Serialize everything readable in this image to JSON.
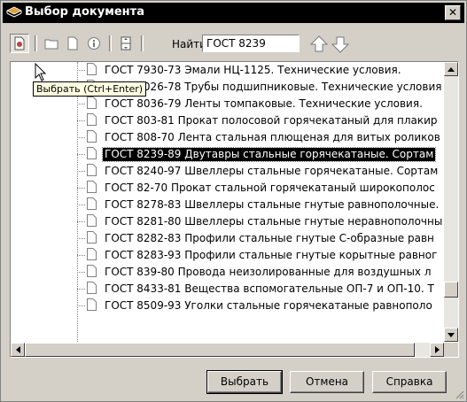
{
  "window": {
    "title": "Выбор документа",
    "close_label": "✕"
  },
  "toolbar": {
    "find_label": "Найти",
    "find_value": "ГОСТ 8239",
    "icons": [
      "select-icon",
      "folder-icon",
      "document-icon",
      "info-icon",
      "split-icon",
      "arrow-up-icon",
      "arrow-down-icon"
    ]
  },
  "tooltip": {
    "text": "Выбрать (Ctrl+Enter)"
  },
  "tree": {
    "selected_index": 5,
    "items": [
      "ГОСТ 7930-73 Эмали НЦ-1125. Технические условия.",
      "ГОСТ 8026-78 Трубы подшипниковые. Технические условия",
      "ГОСТ 8036-79 Ленты томпаковые. Технические условия.",
      "ГОСТ 803-81 Прокат полосовой горячекатаный для плакир",
      "ГОСТ 808-70 Лента стальная плющеная для витых роликов",
      "ГОСТ 8239-89 Двутавры стальные горячекатаные. Сортам",
      "ГОСТ 8240-97 Швеллеры стальные горячекатаные. Сортам",
      "ГОСТ 82-70 Прокат стальной горячекатаный широкополос",
      "ГОСТ 8278-83 Швеллеры стальные гнутые равнополочные.",
      "ГОСТ 8281-80 Швеллеры стальные гнутые неравнополочны",
      "ГОСТ 8282-83 Профили стальные гнутые С-образные равн",
      "ГОСТ 8283-93 Профили стальные гнутые корытные равног",
      "ГОСТ 839-80 Провода неизолированные для воздушных л",
      "ГОСТ 8433-81 Вещества вспомогательные ОП-7 и ОП-10. Т",
      "ГОСТ 8509-93 Уголки стальные горячекатаные равнополо"
    ]
  },
  "buttons": {
    "select": "Выбрать",
    "cancel": "Отмена",
    "help": "Справка"
  }
}
